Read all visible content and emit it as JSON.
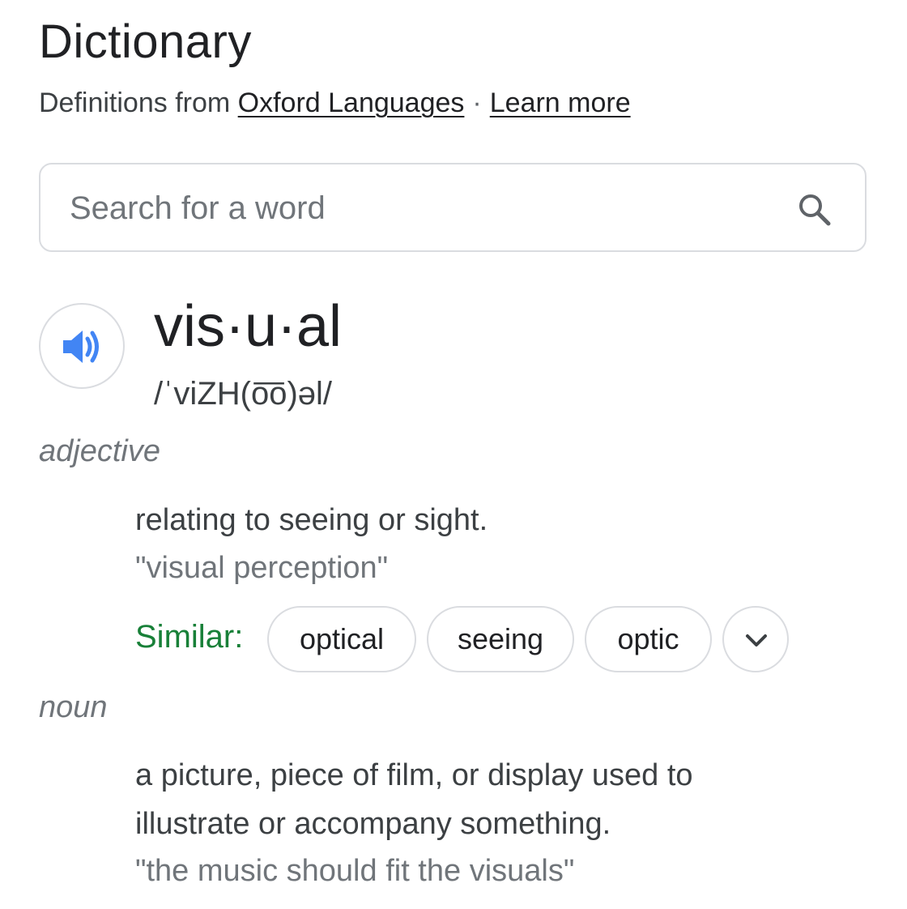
{
  "header": {
    "title": "Dictionary",
    "source_prefix": "Definitions from",
    "source_link": "Oxford Languages",
    "separator": "·",
    "learn_more": "Learn more"
  },
  "search": {
    "placeholder": "Search for a word",
    "value": ""
  },
  "entry": {
    "headword": "vis·u·al",
    "phonetic": "/ˈviZH(o͞o)əl/",
    "audio_icon": "speaker-icon",
    "senses": [
      {
        "part_of_speech": "adjective",
        "definition": "relating to seeing or sight.",
        "example": "\"visual perception\"",
        "similar_label": "Similar:",
        "similar": [
          "optical",
          "seeing",
          "optic"
        ],
        "expand_icon": "chevron-down-icon"
      },
      {
        "part_of_speech": "noun",
        "definition": "a picture, piece of film, or display used to illustrate or accompany something.",
        "example": "\"the music should fit the visuals\""
      }
    ]
  },
  "colors": {
    "accent_blue": "#4285f4",
    "similar_green": "#188038",
    "border": "#dadce0",
    "muted_text": "#70757a"
  }
}
